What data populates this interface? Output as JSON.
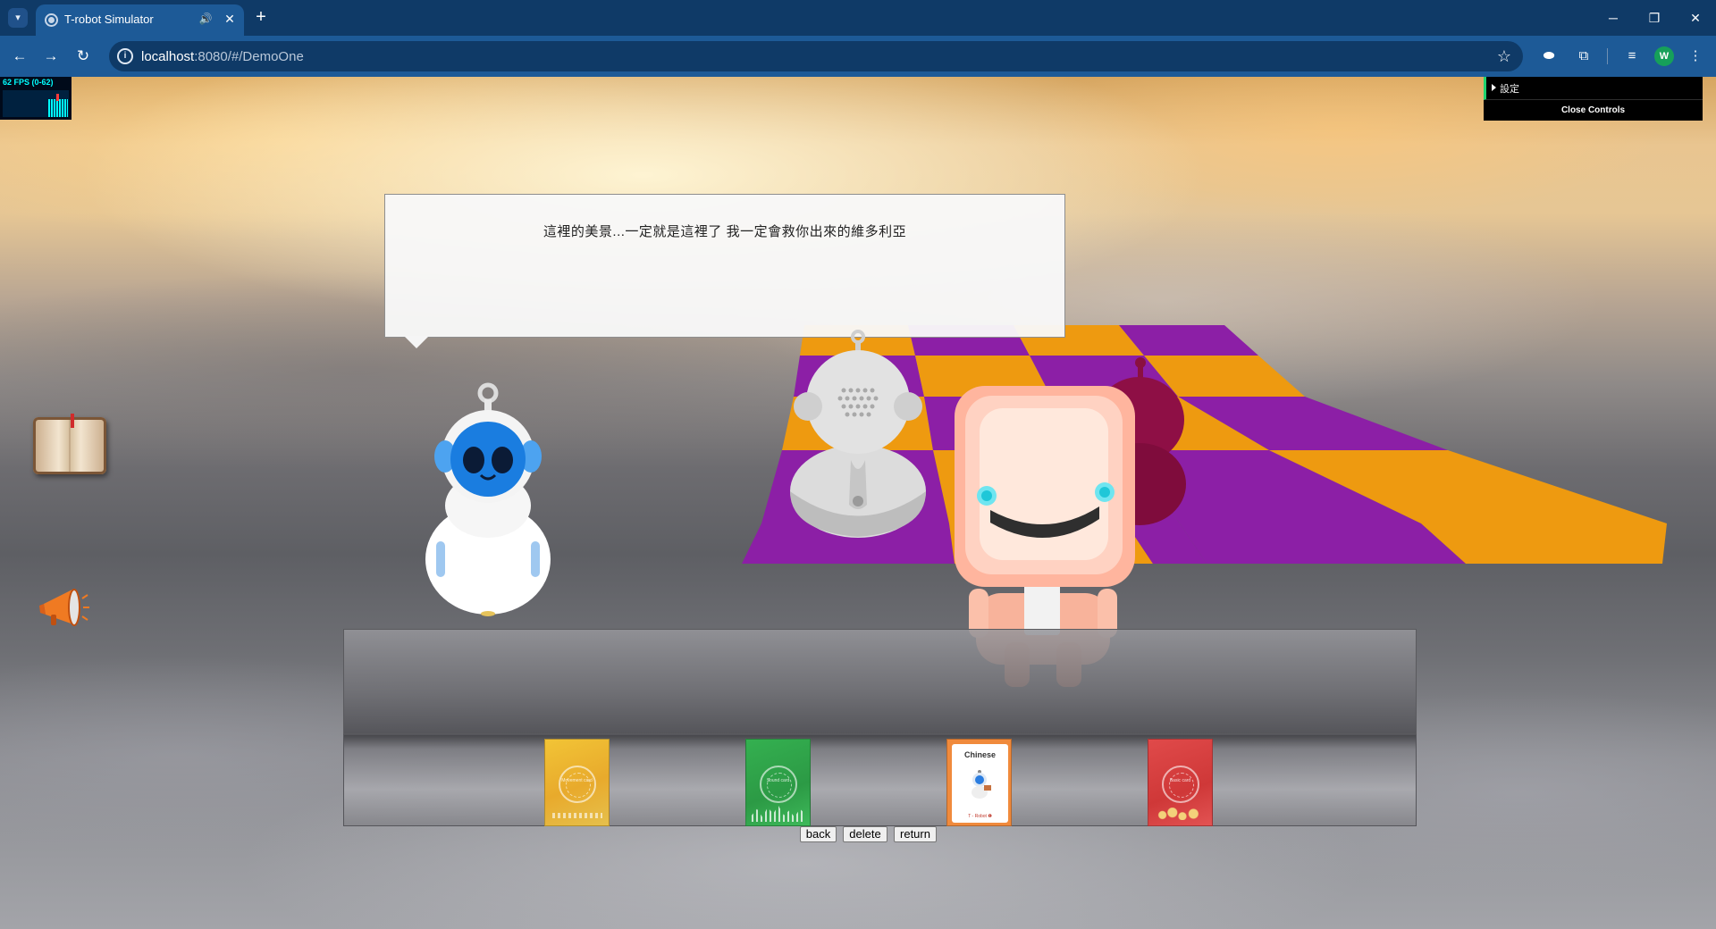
{
  "browser": {
    "tab_title": "T-robot Simulator",
    "url_host": "localhost",
    "url_path": ":8080/#/DemoOne"
  },
  "stats": {
    "fps_label": "62 FPS (0-62)"
  },
  "controls": {
    "folder_label": "設定",
    "close_label": "Close Controls"
  },
  "dialog": {
    "text": "這裡的美景...一定就是這裡了 我一定會救你出來的維多利亞"
  },
  "cards": [
    {
      "name": "yellow",
      "label": "Movement card"
    },
    {
      "name": "green",
      "label": "Sound card"
    },
    {
      "name": "orange",
      "title": "Chinese",
      "footer": "T - Robot ❶"
    },
    {
      "name": "red",
      "label": "Basic card"
    }
  ],
  "actions": {
    "back_label": "back",
    "delete_label": "delete",
    "return_label": "return"
  },
  "colors": {
    "board_purple": "#8c1fa6",
    "board_orange": "#ee9a10",
    "chrome_tabstrip": "#0f3a67",
    "chrome_toolbar": "#1d5a97"
  },
  "icons": [
    "tab-search-icon",
    "globe-icon",
    "speaker-icon",
    "close-icon",
    "plus-icon",
    "minimize-icon",
    "restore-icon",
    "back-arrow-icon",
    "forward-arrow-icon",
    "reload-icon",
    "site-info-icon",
    "star-icon",
    "extension-icon",
    "puzzle-icon",
    "media-icon",
    "menu-icon",
    "book-icon",
    "megaphone-icon"
  ]
}
